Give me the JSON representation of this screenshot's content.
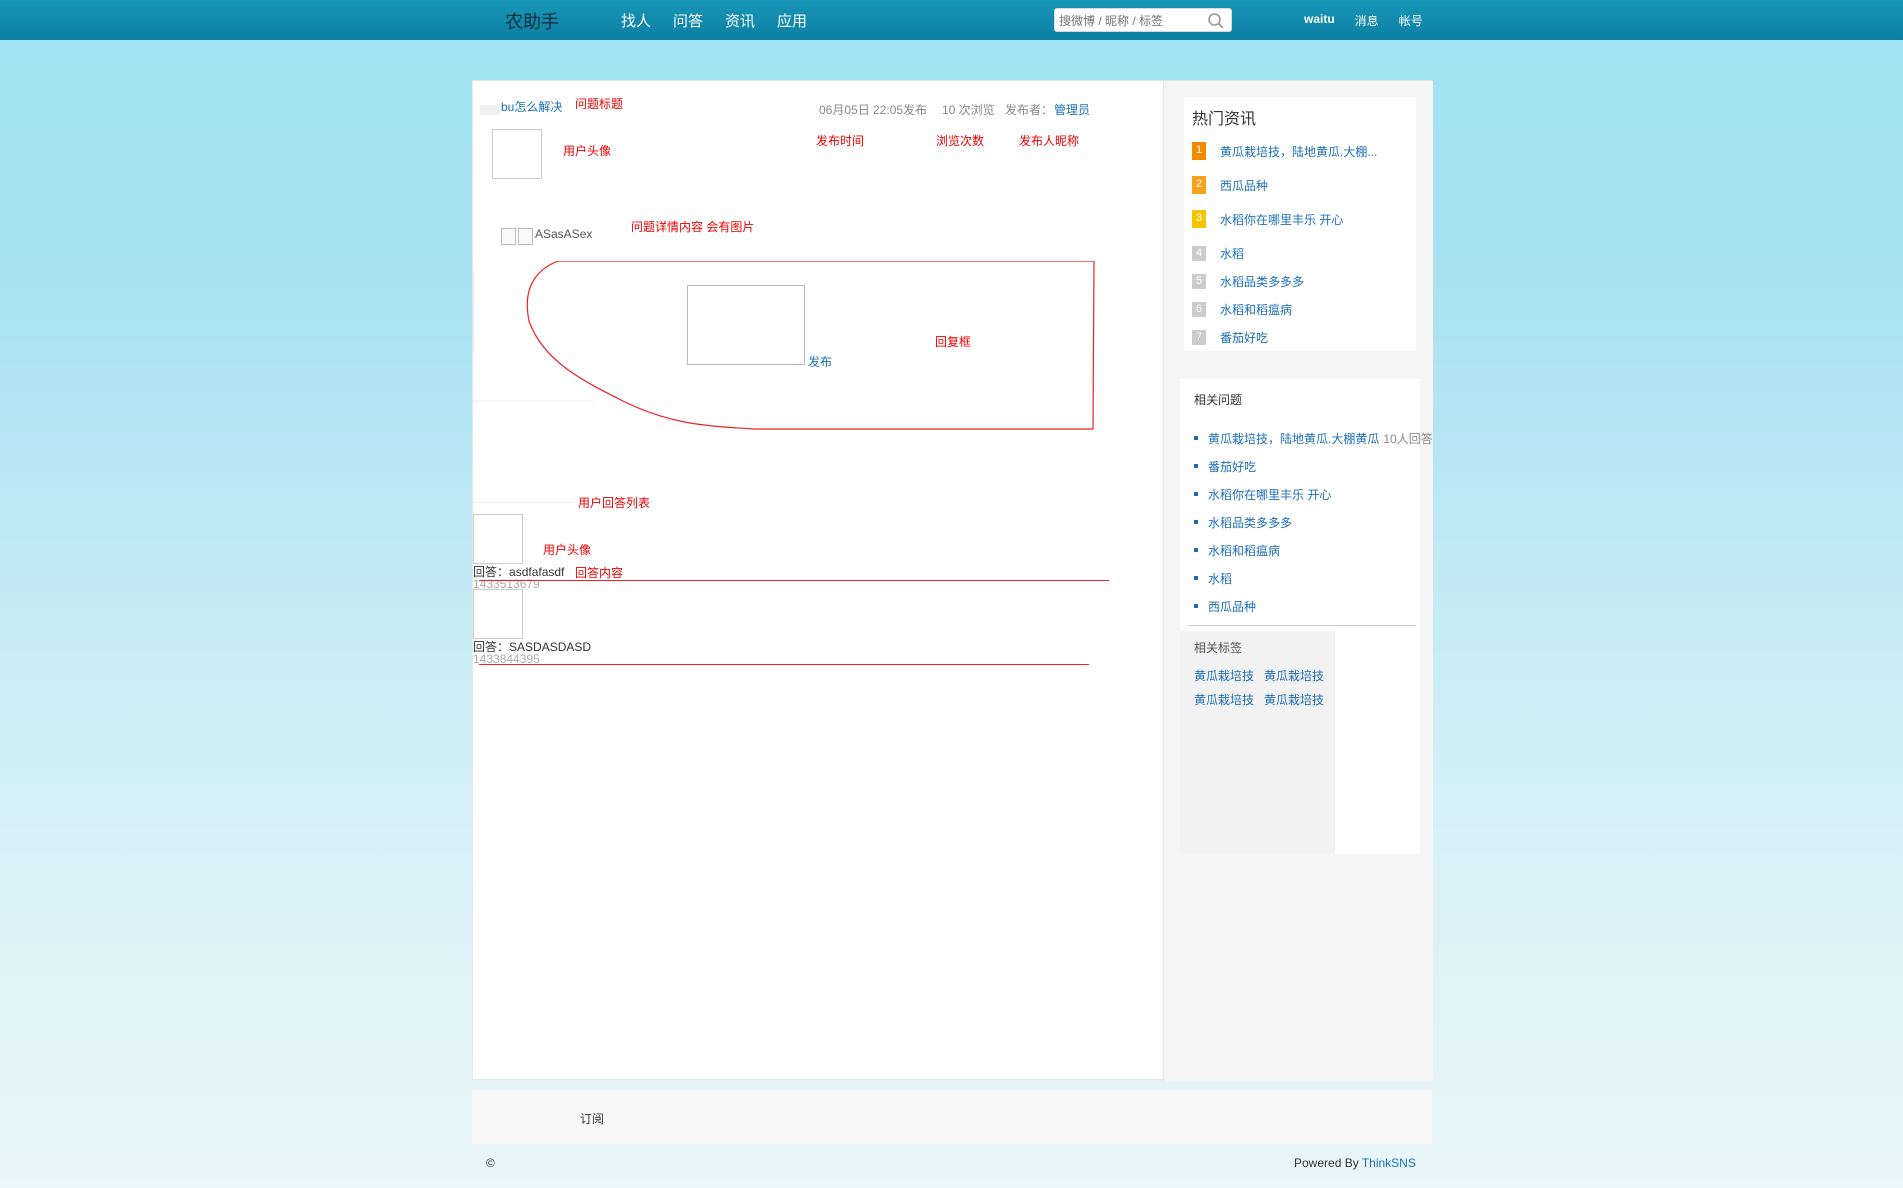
{
  "topbar": {
    "logo": "农助手",
    "nav": [
      "找人",
      "问答",
      "资讯",
      "应用"
    ],
    "search_placeholder": "搜微博 / 昵称 / 标签",
    "user_name": "waitu",
    "messages": "消息",
    "account": "帐号"
  },
  "question": {
    "title": "bu怎么解决",
    "title_note": "问题标题",
    "date": "06月05日 22:05发布",
    "views": "10 次浏览",
    "publisher_label": "发布者：",
    "publisher": "管理员",
    "avatar_note": "用户头像",
    "date_note": "发布时间",
    "views_note": "浏览次数",
    "publisher_note": "发布人昵称",
    "content": "ASasASex",
    "content_note": "问题详情内容  会有图片",
    "reply_note": "回复框",
    "submit": "发布"
  },
  "answers": {
    "list_note": "用户回答列表",
    "avatar_note": "用户头像",
    "content_note": "回答内容",
    "items": [
      {
        "label": "回答：",
        "text": "asdfafasdf",
        "time": "1433513679"
      },
      {
        "label": "回答：",
        "text": "SASDASDASD",
        "time": "1433844395"
      }
    ]
  },
  "sidebar": {
    "hot_title": "热门资讯",
    "hot_items": [
      {
        "rank": "1",
        "text": "黄瓜栽培技，陆地黄瓜.大棚..."
      },
      {
        "rank": "2",
        "text": "西瓜品种"
      },
      {
        "rank": "3",
        "text": "水稻你在哪里丰乐 开心"
      },
      {
        "rank": "4",
        "text": "水稻"
      },
      {
        "rank": "5",
        "text": "水稻品类多多多"
      },
      {
        "rank": "6",
        "text": "水稻和稻瘟病"
      },
      {
        "rank": "7",
        "text": "番茄好吃"
      }
    ],
    "badge_colors": [
      "#f28a00",
      "#f7a21b",
      "#f6c500"
    ],
    "related_title": "相关问题",
    "related_items": [
      {
        "text": "黄瓜栽培技，陆地黄瓜.大棚黄瓜",
        "count": "10人回答"
      },
      {
        "text": "番茄好吃",
        "count": ""
      },
      {
        "text": "水稻你在哪里丰乐 开心",
        "count": ""
      },
      {
        "text": "水稻品类多多多",
        "count": ""
      },
      {
        "text": "水稻和稻瘟病",
        "count": ""
      },
      {
        "text": "水稻",
        "count": ""
      },
      {
        "text": "西瓜品种",
        "count": ""
      }
    ],
    "tags_title": "相关标签",
    "tags": [
      "黄瓜栽培技",
      "黄瓜栽培技",
      "黄瓜栽培技",
      "黄瓜栽培技"
    ]
  },
  "footer": {
    "subscribe": "订阅",
    "copyright": "©",
    "powered_label": "Powered By ",
    "powered_link": "ThinkSNS"
  }
}
